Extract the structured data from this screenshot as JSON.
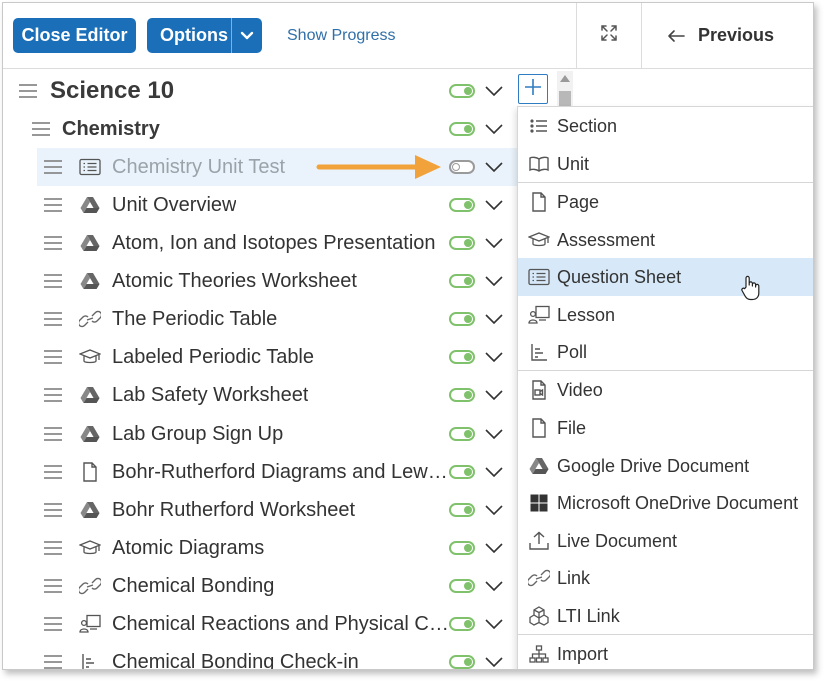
{
  "toolbar": {
    "close_label": "Close Editor",
    "options_label": "Options",
    "show_progress_label": "Show Progress",
    "previous_label": "Previous"
  },
  "tree": {
    "root": {
      "title": "Science 10",
      "visible": true
    },
    "folder": {
      "title": "Chemistry",
      "visible": true
    },
    "items": [
      {
        "title": "Chemistry Unit Test",
        "icon": "question-sheet-icon",
        "visible": false,
        "highlighted": true
      },
      {
        "title": "Unit Overview",
        "icon": "google-drive-icon",
        "visible": true
      },
      {
        "title": "Atom, Ion and Isotopes Presentation",
        "icon": "google-drive-icon",
        "visible": true
      },
      {
        "title": "Atomic Theories Worksheet",
        "icon": "google-drive-icon",
        "visible": true
      },
      {
        "title": "The Periodic Table",
        "icon": "link-icon",
        "visible": true
      },
      {
        "title": "Labeled Periodic Table",
        "icon": "assessment-icon",
        "visible": true
      },
      {
        "title": "Lab Safety Worksheet",
        "icon": "google-drive-icon",
        "visible": true
      },
      {
        "title": "Lab Group Sign Up",
        "icon": "google-drive-icon",
        "visible": true
      },
      {
        "title": "Bohr-Rutherford Diagrams and Lewis Dot Diagrams",
        "icon": "page-icon",
        "visible": true
      },
      {
        "title": "Bohr Rutherford Worksheet",
        "icon": "google-drive-icon",
        "visible": true
      },
      {
        "title": "Atomic Diagrams",
        "icon": "assessment-icon",
        "visible": true
      },
      {
        "title": "Chemical Bonding",
        "icon": "link-icon",
        "visible": true
      },
      {
        "title": "Chemical Reactions and Physical Changes",
        "icon": "lesson-icon",
        "visible": true
      },
      {
        "title": "Chemical Bonding Check-in",
        "icon": "poll-icon",
        "visible": true
      }
    ]
  },
  "add_menu": {
    "items": [
      {
        "label": "Section",
        "icon": "section-icon"
      },
      {
        "label": "Unit",
        "icon": "unit-icon"
      },
      {
        "label": "Page",
        "icon": "page-icon"
      },
      {
        "label": "Assessment",
        "icon": "assessment-icon"
      },
      {
        "label": "Question Sheet",
        "icon": "question-sheet-icon",
        "active": true
      },
      {
        "label": "Lesson",
        "icon": "lesson-icon"
      },
      {
        "label": "Poll",
        "icon": "poll-icon"
      },
      {
        "label": "Video",
        "icon": "video-icon"
      },
      {
        "label": "File",
        "icon": "file-icon"
      },
      {
        "label": "Google Drive Document",
        "icon": "google-drive-icon"
      },
      {
        "label": "Microsoft OneDrive Document",
        "icon": "onedrive-icon"
      },
      {
        "label": "Live Document",
        "icon": "live-document-icon"
      },
      {
        "label": "Link",
        "icon": "link-icon"
      },
      {
        "label": "LTI Link",
        "icon": "lti-link-icon"
      },
      {
        "label": "Import",
        "icon": "import-icon"
      }
    ]
  },
  "colors": {
    "primary": "#1a6fb8",
    "toggle_on": "#7fc26b",
    "menu_active": "#d7e9f8",
    "row_highlight": "#eaf3fb",
    "annotation_arrow": "#f2a23a"
  }
}
